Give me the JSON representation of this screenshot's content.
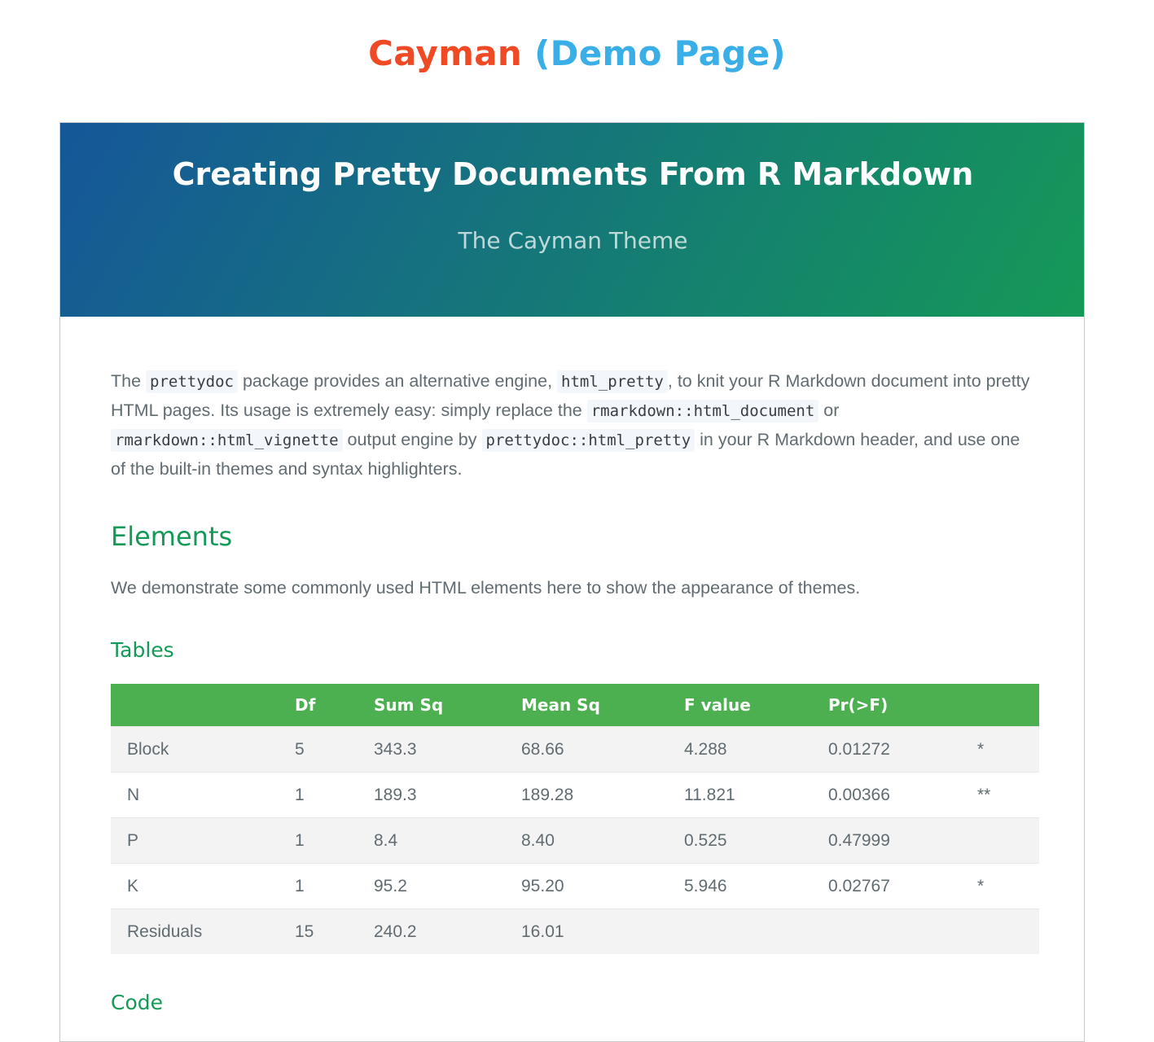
{
  "banner": {
    "theme_name": "Cayman",
    "demo_label": "(Demo Page)",
    "theme_color": "#ef4a24",
    "demo_color": "#39aee7"
  },
  "header": {
    "title": "Creating Pretty Documents From R Markdown",
    "subtitle": "The Cayman Theme",
    "gradient_start": "#155799",
    "gradient_end": "#159957"
  },
  "intro": {
    "t1": "The ",
    "c1": "prettydoc",
    "t2": " package provides an alternative engine, ",
    "c2": "html_pretty",
    "t3": ", to knit your R Markdown document into pretty HTML pages. Its usage is extremely easy: simply replace the ",
    "c3": "rmarkdown::html_document",
    "t4": " or ",
    "c4": "rmarkdown::html_vignette",
    "t5": " output engine by ",
    "c5": "prettydoc::html_pretty",
    "t6": " in your R Markdown header, and use one of the built-in themes and syntax highlighters."
  },
  "elements": {
    "heading": "Elements",
    "description": "We demonstrate some commonly used HTML elements here to show the appearance of themes."
  },
  "tables": {
    "heading": "Tables",
    "header_color": "#4caf50",
    "columns": [
      "",
      "Df",
      "Sum Sq",
      "Mean Sq",
      "F value",
      "Pr(>F)",
      ""
    ],
    "rows": [
      [
        "Block",
        "5",
        "343.3",
        "68.66",
        "4.288",
        "0.01272",
        "*"
      ],
      [
        "N",
        "1",
        "189.3",
        "189.28",
        "11.821",
        "0.00366",
        "**"
      ],
      [
        "P",
        "1",
        "8.4",
        "8.40",
        "0.525",
        "0.47999",
        ""
      ],
      [
        "K",
        "1",
        "95.2",
        "95.20",
        "5.946",
        "0.02767",
        "*"
      ],
      [
        "Residuals",
        "15",
        "240.2",
        "16.01",
        "",
        "",
        ""
      ]
    ]
  },
  "code": {
    "heading": "Code"
  }
}
